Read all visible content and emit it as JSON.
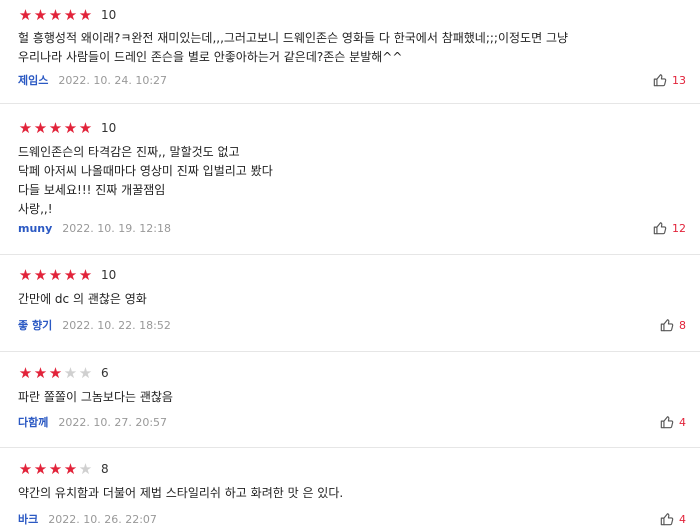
{
  "colors": {
    "star_on": "#e2233a",
    "star_off": "#d0d0d0",
    "author": "#2b59c3",
    "like_count": "#e2233a",
    "date": "#999999"
  },
  "reviews": [
    {
      "rating": 5,
      "score": "10",
      "text": "헐  흥행성적 왜이래?ㅋ완전 재미있는데,,,그러고보니 드웨인존슨 영화들 다 한국에서 참패했네;;;이정도면 그냥\n우리나라 사람들이 드레인 존슨을 별로 안좋아하는거 같은데?존슨 분발해^^",
      "author": "제임스",
      "date": "2022. 10. 24. 10:27",
      "likes": "13"
    },
    {
      "rating": 5,
      "score": "10",
      "text": "드웨인존슨의 타격감은 진짜,, 말할것도 없고\n닥페 아저씨 나올때마다 영상미 진짜 입벌리고 봤다\n다들 보세요!!! 진짜 개꿀잼임\n사랑,,!",
      "author": "muny",
      "date": "2022. 10. 19. 12:18",
      "likes": "12"
    },
    {
      "rating": 5,
      "score": "10",
      "text": "간만에 dc 의 괜찮은 영화",
      "author": "좋 향기",
      "date": "2022. 10. 22. 18:52",
      "likes": "8"
    },
    {
      "rating": 3,
      "score": "6",
      "text": "파란 쫄쫄이 그놈보다는 괜찮음",
      "author": "다함께",
      "date": "2022. 10. 27. 20:57",
      "likes": "4"
    },
    {
      "rating": 4,
      "score": "8",
      "text": "약간의 유치함과 더불어 제법  스타일리쉬 하고 화려한 맛 은 있다.",
      "author": "바크",
      "date": "2022. 10. 26. 22:07",
      "likes": "4"
    }
  ]
}
